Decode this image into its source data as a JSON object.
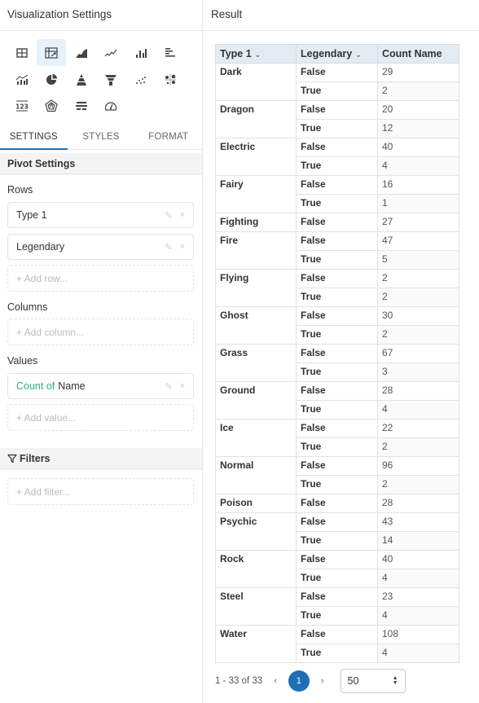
{
  "left_panel": {
    "title": "Visualization Settings",
    "viz_types": [
      {
        "icon": "table-icon",
        "active": false
      },
      {
        "icon": "pivot-table-icon",
        "active": true
      },
      {
        "icon": "area-chart-icon",
        "active": false
      },
      {
        "icon": "line-chart-icon",
        "active": false
      },
      {
        "icon": "bar-chart-icon",
        "active": false
      },
      {
        "icon": "horizontal-bar-chart-icon",
        "active": false
      },
      {
        "icon": "combo-chart-icon",
        "active": false
      },
      {
        "icon": "pie-chart-icon",
        "active": false
      },
      {
        "icon": "pyramid-chart-icon",
        "active": false
      },
      {
        "icon": "funnel-chart-icon",
        "active": false
      },
      {
        "icon": "scatter-chart-icon",
        "active": false
      },
      {
        "icon": "bubble-chart-icon",
        "active": false
      },
      {
        "icon": "number-icon",
        "active": false
      },
      {
        "icon": "radar-chart-icon",
        "active": false
      },
      {
        "icon": "bullet-chart-icon",
        "active": false
      },
      {
        "icon": "gauge-icon",
        "active": false
      }
    ],
    "tabs": [
      {
        "label": "SETTINGS",
        "active": true
      },
      {
        "label": "STYLES",
        "active": false
      },
      {
        "label": "FORMAT",
        "active": false
      }
    ],
    "pivot_settings": {
      "title": "Pivot Settings",
      "rows_label": "Rows",
      "rows": [
        "Type 1",
        "Legendary"
      ],
      "add_row": "+ Add row...",
      "columns_label": "Columns",
      "add_column": "+ Add column...",
      "values_label": "Values",
      "value": {
        "agg": "Count of",
        "field": "Name"
      },
      "add_value": "+ Add value..."
    },
    "filters": {
      "title": "Filters",
      "add_filter": "+ Add filter..."
    },
    "edit_glyph": "✎",
    "remove_glyph": "×"
  },
  "result": {
    "title": "Result",
    "headers": [
      "Type 1",
      "Legendary",
      "Count Name"
    ],
    "chevron": "⌄",
    "groups": [
      {
        "type": "Dark",
        "rows": [
          [
            "False",
            "29"
          ],
          [
            "True",
            "2"
          ]
        ]
      },
      {
        "type": "Dragon",
        "rows": [
          [
            "False",
            "20"
          ],
          [
            "True",
            "12"
          ]
        ]
      },
      {
        "type": "Electric",
        "rows": [
          [
            "False",
            "40"
          ],
          [
            "True",
            "4"
          ]
        ]
      },
      {
        "type": "Fairy",
        "rows": [
          [
            "False",
            "16"
          ],
          [
            "True",
            "1"
          ]
        ]
      },
      {
        "type": "Fighting",
        "rows": [
          [
            "False",
            "27"
          ]
        ]
      },
      {
        "type": "Fire",
        "rows": [
          [
            "False",
            "47"
          ],
          [
            "True",
            "5"
          ]
        ]
      },
      {
        "type": "Flying",
        "rows": [
          [
            "False",
            "2"
          ],
          [
            "True",
            "2"
          ]
        ]
      },
      {
        "type": "Ghost",
        "rows": [
          [
            "False",
            "30"
          ],
          [
            "True",
            "2"
          ]
        ]
      },
      {
        "type": "Grass",
        "rows": [
          [
            "False",
            "67"
          ],
          [
            "True",
            "3"
          ]
        ]
      },
      {
        "type": "Ground",
        "rows": [
          [
            "False",
            "28"
          ],
          [
            "True",
            "4"
          ]
        ]
      },
      {
        "type": "Ice",
        "rows": [
          [
            "False",
            "22"
          ],
          [
            "True",
            "2"
          ]
        ]
      },
      {
        "type": "Normal",
        "rows": [
          [
            "False",
            "96"
          ],
          [
            "True",
            "2"
          ]
        ]
      },
      {
        "type": "Poison",
        "rows": [
          [
            "False",
            "28"
          ]
        ]
      },
      {
        "type": "Psychic",
        "rows": [
          [
            "False",
            "43"
          ],
          [
            "True",
            "14"
          ]
        ]
      },
      {
        "type": "Rock",
        "rows": [
          [
            "False",
            "40"
          ],
          [
            "True",
            "4"
          ]
        ]
      },
      {
        "type": "Steel",
        "rows": [
          [
            "False",
            "23"
          ],
          [
            "True",
            "4"
          ]
        ]
      },
      {
        "type": "Water",
        "rows": [
          [
            "False",
            "108"
          ],
          [
            "True",
            "4"
          ]
        ]
      }
    ],
    "pagination": {
      "range": "1 - 33 of 33",
      "prev": "‹",
      "current_page": "1",
      "next": "›",
      "page_size": "50"
    }
  },
  "colors": {
    "accent": "#1f6fb5",
    "green": "#2ab27b",
    "header_bg": "#e4ecf3",
    "active_viz_bg": "#e8f2fb"
  }
}
